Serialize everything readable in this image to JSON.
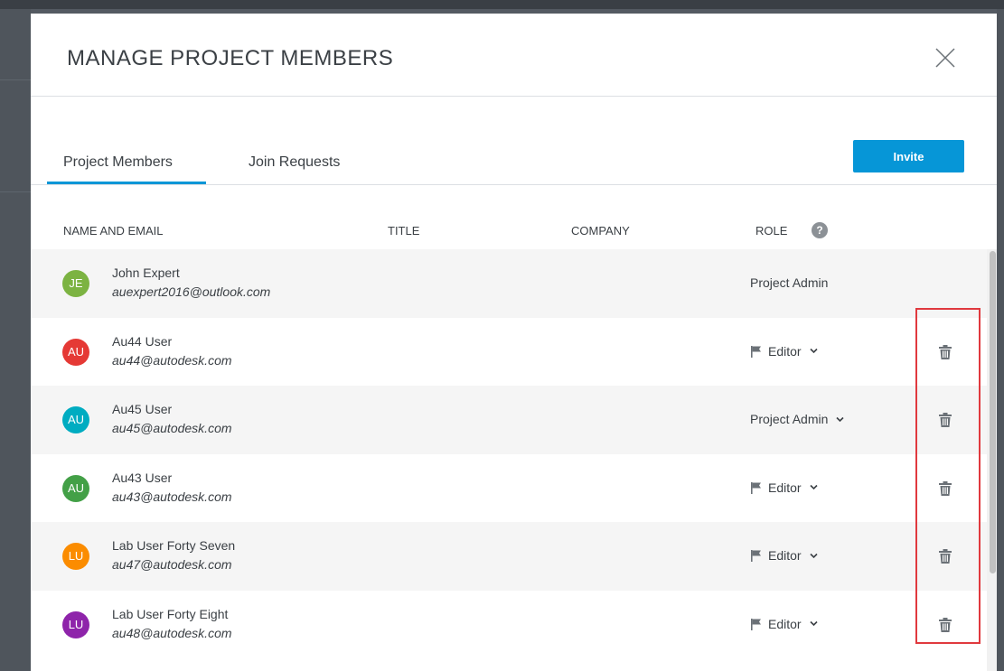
{
  "modal": {
    "title": "MANAGE PROJECT MEMBERS"
  },
  "tabs": [
    {
      "label": "Project Members",
      "active": true
    },
    {
      "label": "Join Requests",
      "active": false
    }
  ],
  "invite_label": "Invite",
  "columns": {
    "name_email": "NAME AND EMAIL",
    "title": "TITLE",
    "company": "COMPANY",
    "role": "ROLE",
    "role_help_icon": "?"
  },
  "members": [
    {
      "initials": "JE",
      "avatar_color": "#7cb342",
      "name": "John Expert",
      "email": "auexpert2016@outlook.com",
      "role": "Project Admin",
      "role_editable": false,
      "role_flag": false,
      "deletable": false
    },
    {
      "initials": "AU",
      "avatar_color": "#e53935",
      "name": "Au44 User",
      "email": "au44@autodesk.com",
      "role": "Editor",
      "role_editable": true,
      "role_flag": true,
      "deletable": true
    },
    {
      "initials": "AU",
      "avatar_color": "#00acc1",
      "name": "Au45 User",
      "email": "au45@autodesk.com",
      "role": "Project Admin",
      "role_editable": true,
      "role_flag": false,
      "deletable": true
    },
    {
      "initials": "AU",
      "avatar_color": "#43a047",
      "name": "Au43 User",
      "email": "au43@autodesk.com",
      "role": "Editor",
      "role_editable": true,
      "role_flag": true,
      "deletable": true
    },
    {
      "initials": "LU",
      "avatar_color": "#fb8c00",
      "name": "Lab User Forty Seven",
      "email": "au47@autodesk.com",
      "role": "Editor",
      "role_editable": true,
      "role_flag": true,
      "deletable": true
    },
    {
      "initials": "LU",
      "avatar_color": "#8e24aa",
      "name": "Lab User Forty Eight",
      "email": "au48@autodesk.com",
      "role": "Editor",
      "role_editable": true,
      "role_flag": true,
      "deletable": true
    }
  ],
  "colors": {
    "accent": "#0696d7",
    "highlight": "#e0393e"
  },
  "icons": {
    "close": "close-icon",
    "flag": "flag-icon",
    "chevron": "chevron-down-icon",
    "trash": "trash-icon",
    "help": "help-icon"
  }
}
